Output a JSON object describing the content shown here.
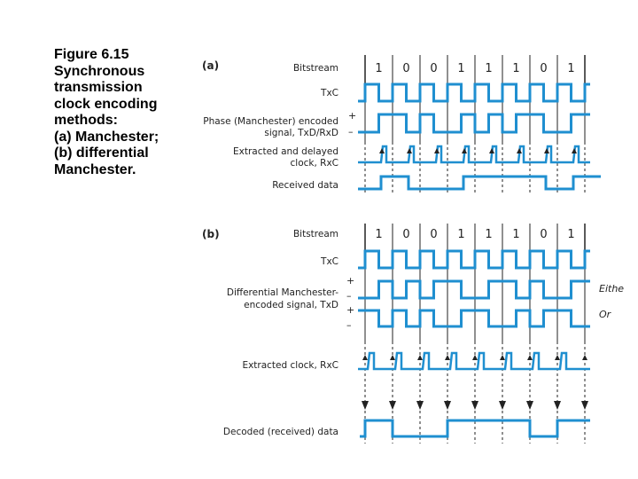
{
  "caption": {
    "lines": [
      "Figure 6.15",
      "Synchronous",
      "transmission",
      "clock encoding",
      "methods:",
      "(a) Manchester;",
      "(b) differential",
      "Manchester."
    ]
  },
  "colors": {
    "wave": "#1f8fd0",
    "grid": "#222222",
    "text": "#222222"
  },
  "bits": [
    1,
    0,
    0,
    1,
    1,
    1,
    0,
    1
  ],
  "part_a": {
    "tag": "(a)",
    "labels": {
      "bitstream": "Bitstream",
      "txc": "TxC",
      "encoded_1": "Phase (Manchester) encoded",
      "encoded_2": "signal, TxD/RxD",
      "rxc_1": "Extracted and delayed",
      "rxc_2": "clock, RxC",
      "received": "Received data"
    },
    "plus": "+",
    "minus": "–"
  },
  "part_b": {
    "tag": "(b)",
    "labels": {
      "bitstream": "Bitstream",
      "txc": "TxC",
      "encoded_1": "Differential Manchester-",
      "encoded_2": "encoded signal, TxD",
      "rxc": "Extracted clock, RxC",
      "decoded": "Decoded (received) data"
    },
    "plus1": "+",
    "minus1": "–",
    "plus2": "+",
    "minus2": "–",
    "either": "Eithe",
    "or": "Or"
  }
}
